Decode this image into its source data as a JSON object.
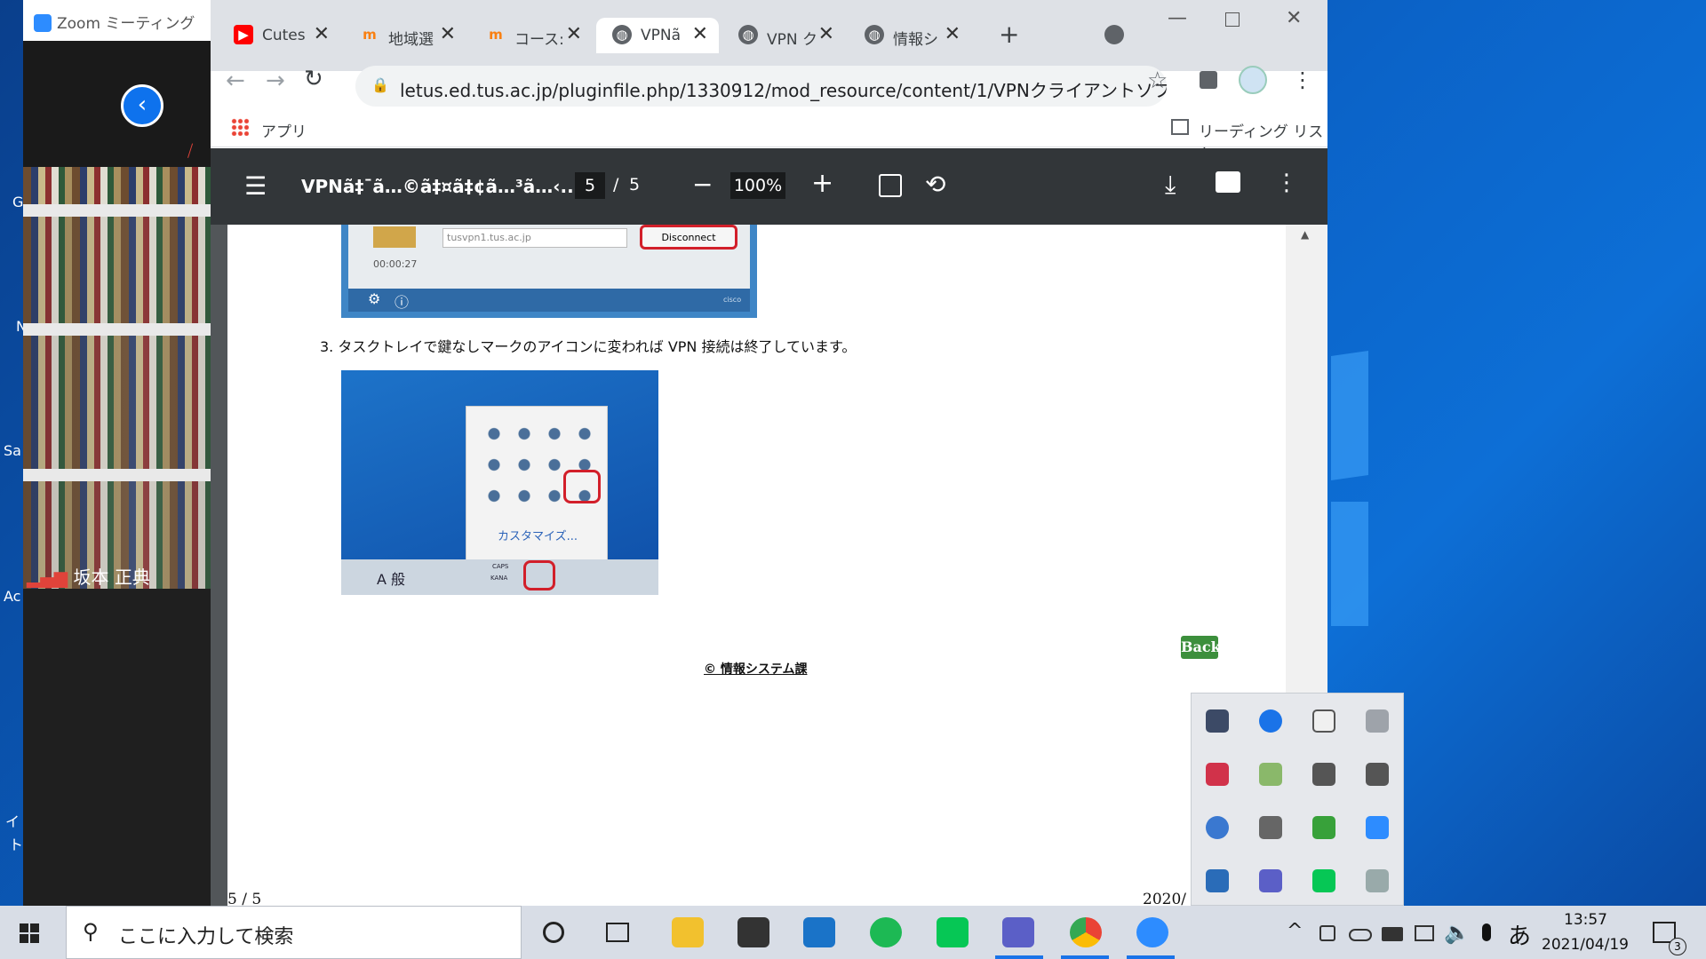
{
  "zoom": {
    "title": "Zoom ミーティング",
    "participant": "坂本 正典"
  },
  "desktop_fragments": [
    "G",
    "N",
    "Sa",
    "Ac",
    "イ",
    "ト"
  ],
  "tabs": [
    {
      "label": "Cutes",
      "icon": "youtube-icon",
      "color": "#ff0000"
    },
    {
      "label": "地域選",
      "icon": "moodle-icon",
      "color": "#f98012"
    },
    {
      "label": "コース:",
      "icon": "moodle-icon",
      "color": "#f98012"
    },
    {
      "label": "VPNã",
      "icon": "globe-icon",
      "color": "#5f6368",
      "active": true
    },
    {
      "label": "VPN ク",
      "icon": "globe-icon",
      "color": "#5f6368"
    },
    {
      "label": "情報シ",
      "icon": "globe-icon",
      "color": "#5f6368"
    }
  ],
  "omnibox": {
    "url": "letus.ed.tus.ac.jp/pluginfile.php/1330912/mod_resource/content/1/VPNクライアントソフト..."
  },
  "bookmarks": {
    "apps": "アプリ",
    "reading_list": "リーディング リスト"
  },
  "pdf": {
    "title": "VPNã‡¯ã…©ã‡¤ã‡¢ã…³ã…‹...",
    "page_current": "5",
    "page_sep": "/",
    "page_total": "5",
    "zoom": "100%"
  },
  "doc": {
    "vpn_server": "tusvpn1.tus.ac.jp",
    "disconnect": "Disconnect",
    "timer": "00:00:27",
    "cisco": "cisco",
    "step3": "3. タスクトレイで鍵なしマークのアイコンに変われば VPN 接続は終了しています。",
    "customize": "カスタマイズ...",
    "ime": "A 般",
    "caps": "CAPS",
    "kana": "KANA",
    "back": "Back",
    "footer": "© 情報システム課",
    "page_label": "5 / 5",
    "date_label": "2020/"
  },
  "taskbar": {
    "search_placeholder": "ここに入力して検索",
    "time": "13:57",
    "date": "2021/04/19",
    "ime": "あ",
    "notif_count": "3"
  }
}
